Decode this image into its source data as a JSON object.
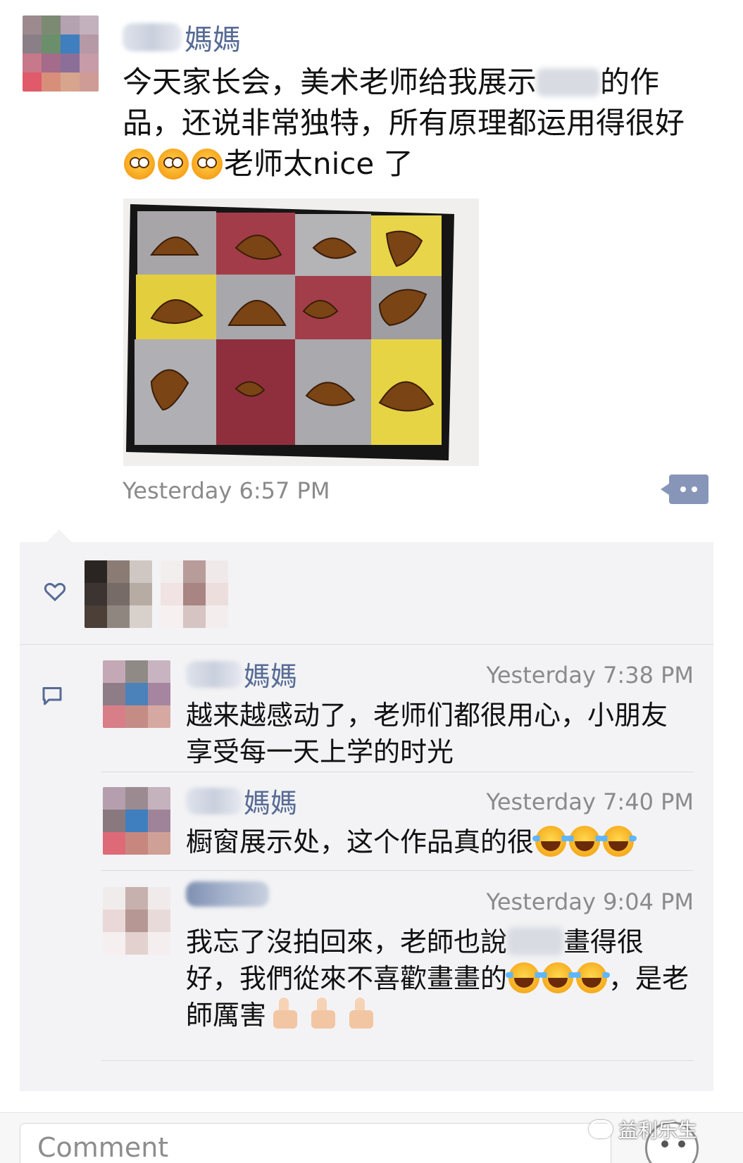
{
  "post": {
    "author_suffix": "媽媽",
    "text_part1": "今天家长会，美术老师给我展示",
    "text_part2": "的作品，还说非常独特，所有原理都运用得很好",
    "text_part3": "老师太nice 了",
    "timestamp": "Yesterday 6:57 PM",
    "photo_description_icon": "artwork-photo"
  },
  "comments": [
    {
      "name_suffix": "媽媽",
      "time": "Yesterday 7:38 PM",
      "text": "越来越感动了，老师们都很用心，小朋友享受每一天上学的时光"
    },
    {
      "name_suffix": "媽媽",
      "time": "Yesterday 7:40 PM",
      "text": "橱窗展示处，这个作品真的很"
    },
    {
      "name_suffix": "",
      "time": "Yesterday 9:04 PM",
      "text_part1": "我忘了沒拍回來，老師也說",
      "text_part2": "畫得很好，我們從來不喜歡畫畫的",
      "text_part3": "，是老師厲害"
    }
  ],
  "input": {
    "placeholder": "Comment"
  },
  "watermark": {
    "text": "益利乐生"
  },
  "icons": {
    "like": "heart-icon",
    "comment": "comment-icon",
    "more": "more-options-icon",
    "emoji": "emoji-button-icon"
  }
}
